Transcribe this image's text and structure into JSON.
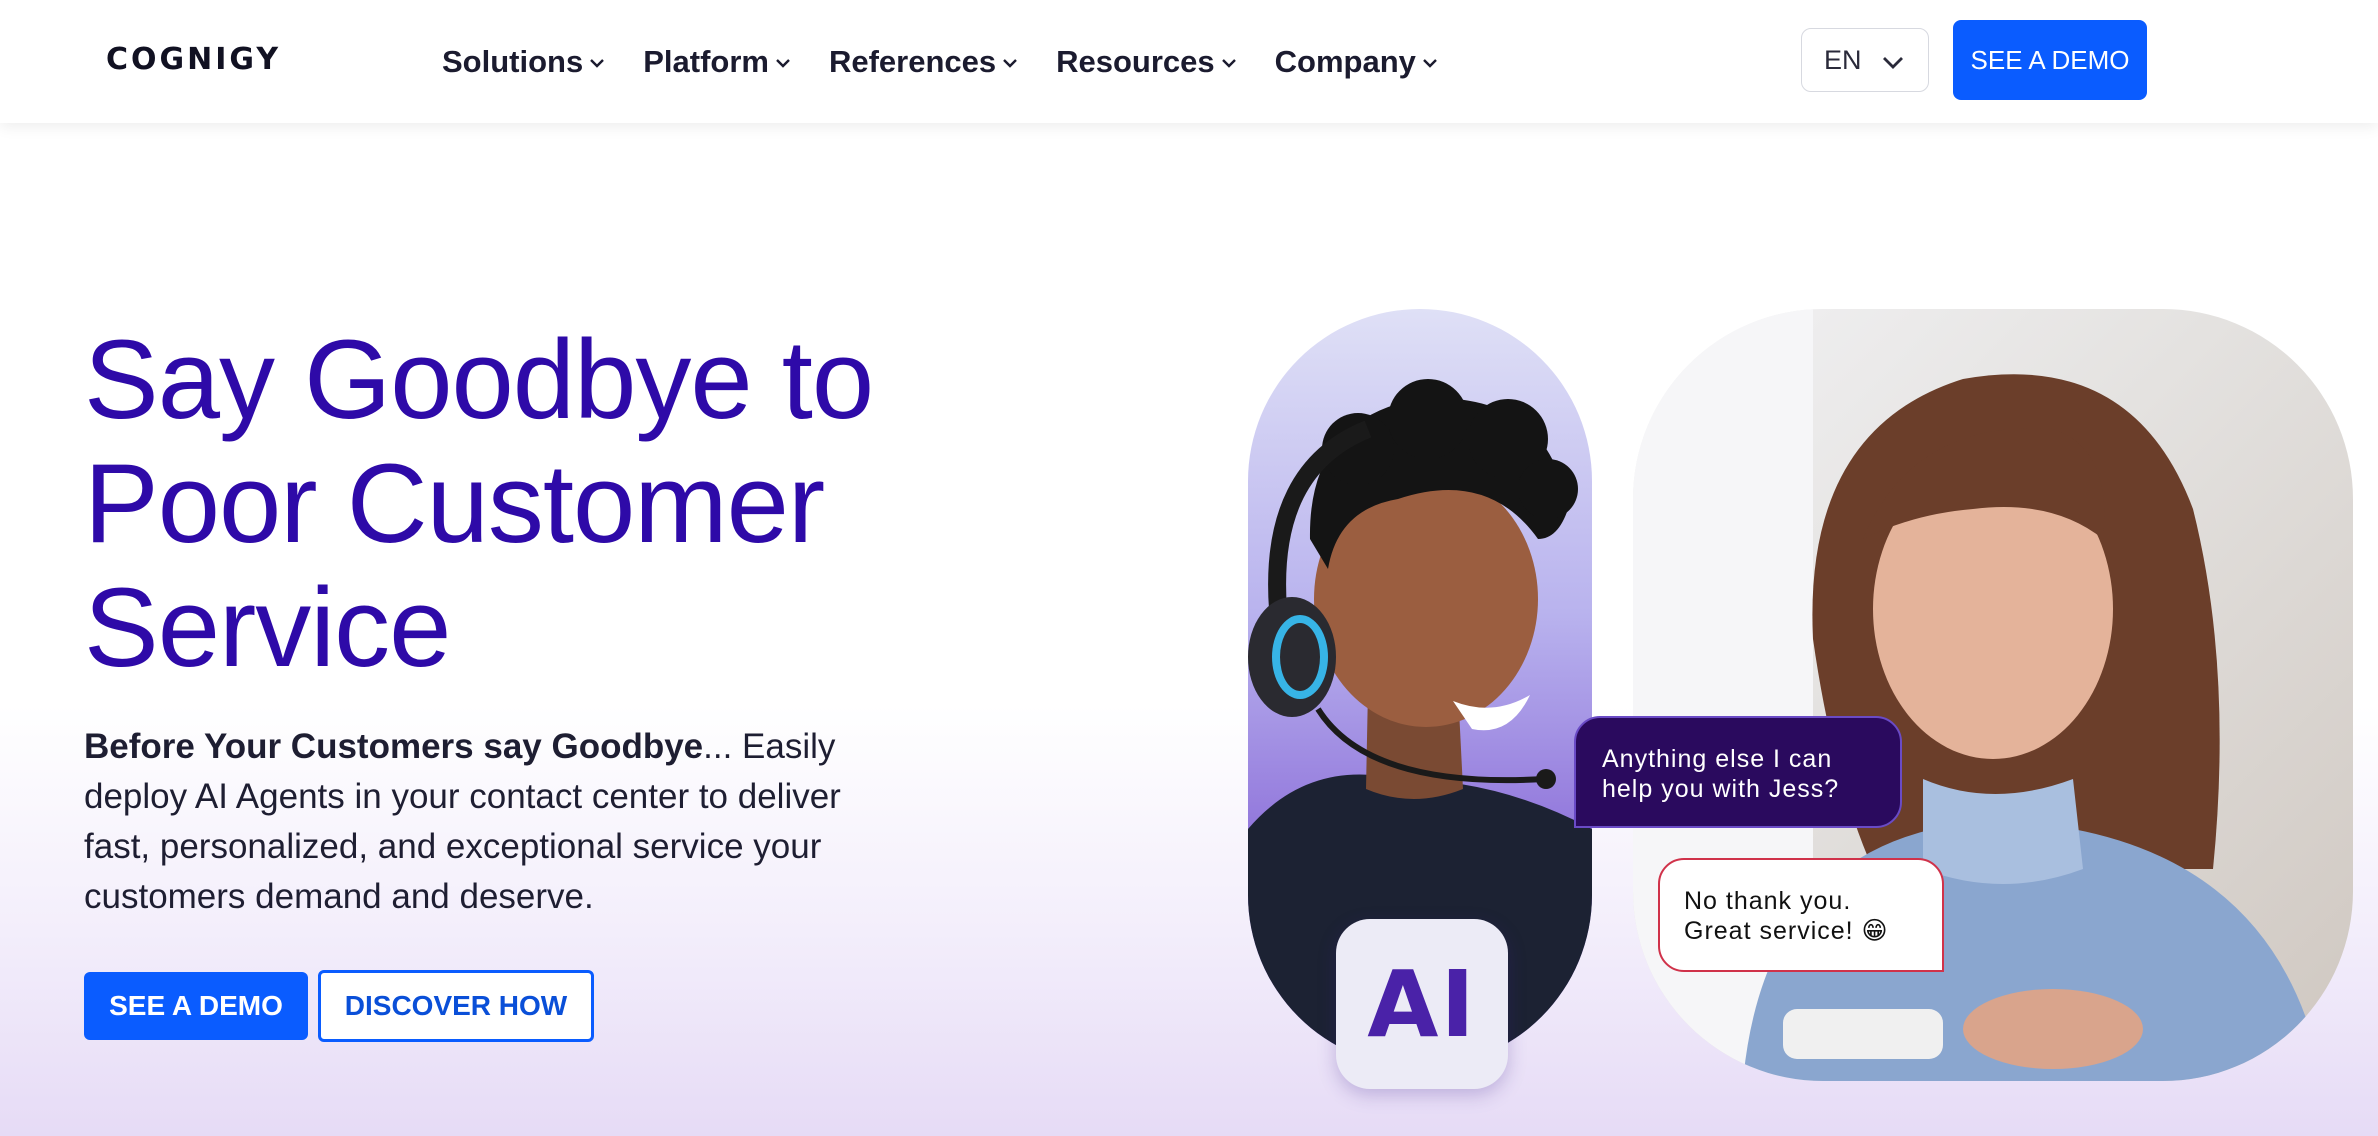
{
  "header": {
    "logo": "COGNIGY",
    "nav": [
      {
        "label": "Solutions"
      },
      {
        "label": "Platform"
      },
      {
        "label": "References"
      },
      {
        "label": "Resources"
      },
      {
        "label": "Company"
      }
    ],
    "language": "EN",
    "cta_label": "SEE A DEMO"
  },
  "hero": {
    "title_lines": [
      "Say Goodbye to",
      "Poor Customer",
      "Service"
    ],
    "body_bold": "Before Your Customers say Goodbye",
    "body_rest": "... Easily deploy AI Agents in your contact center to deliver fast, personalized, and exceptional service your customers demand and deserve.",
    "primary_button": "SEE A DEMO",
    "secondary_button": "DISCOVER HOW"
  },
  "visual": {
    "ai_badge": "AI",
    "agent_message": "Anything else I can help you with Jess?",
    "customer_message": "No thank you. Great service! 😁"
  },
  "colors": {
    "brand_blue": "#0a5cff",
    "title_purple": "#2e0aa8",
    "agent_bubble": "#2a0a5e"
  },
  "icons": {
    "nav_dropdown": "chevron-down-icon",
    "lang_dropdown": "chevron-down-icon"
  }
}
